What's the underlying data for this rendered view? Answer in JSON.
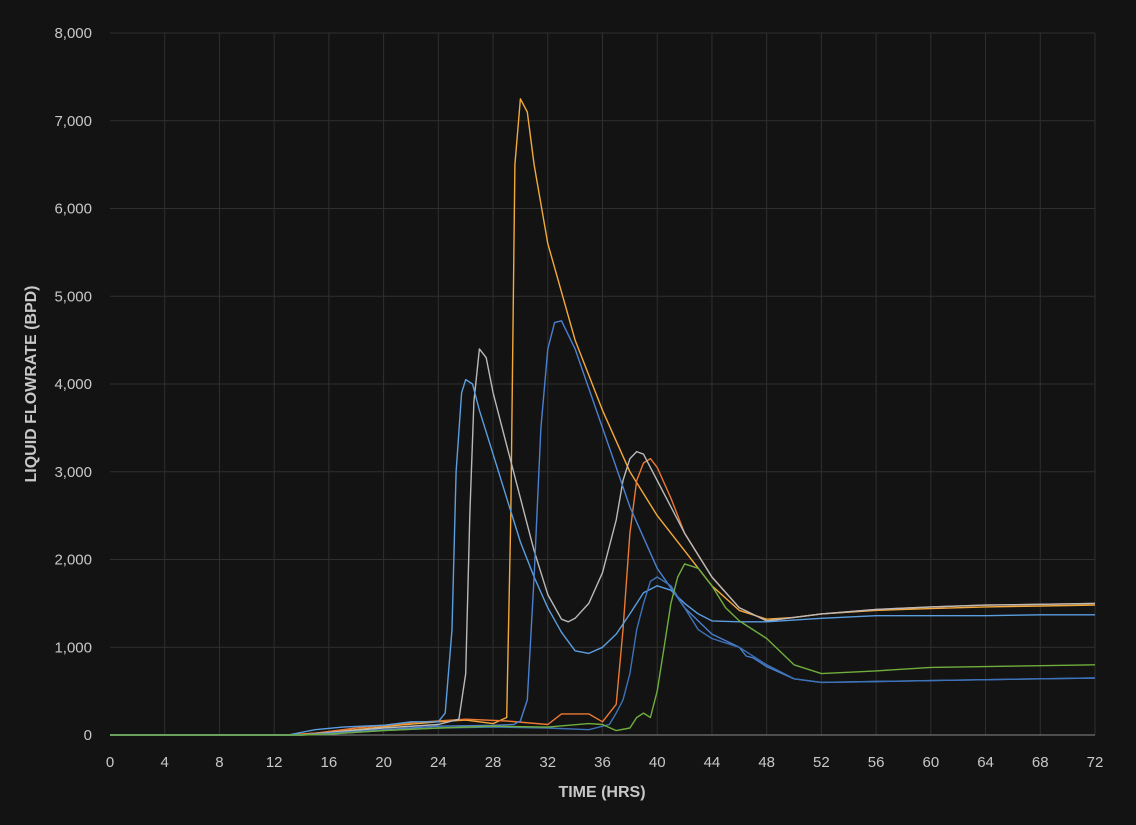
{
  "chart_data": {
    "type": "line",
    "xlabel": "TIME (HRS)",
    "ylabel": "LIQUID FLOWRATE (BPD)",
    "xlim": [
      0,
      72
    ],
    "ylim": [
      0,
      8000
    ],
    "x_ticks": [
      "0",
      "4",
      "8",
      "12",
      "16",
      "20",
      "24",
      "28",
      "32",
      "36",
      "40",
      "44",
      "48",
      "52",
      "56",
      "60",
      "64",
      "68",
      "72"
    ],
    "y_ticks": [
      "0",
      "1,000",
      "2,000",
      "3,000",
      "4,000",
      "5,000",
      "6,000",
      "7,000",
      "8,000"
    ],
    "grid": true,
    "background": "#131313",
    "series": [
      {
        "color": "#f2a93b",
        "points": [
          [
            0,
            0
          ],
          [
            13,
            0
          ],
          [
            15,
            20
          ],
          [
            18,
            60
          ],
          [
            21,
            110
          ],
          [
            24,
            150
          ],
          [
            26,
            170
          ],
          [
            28,
            130
          ],
          [
            29,
            200
          ],
          [
            29.3,
            2500
          ],
          [
            29.6,
            6500
          ],
          [
            30,
            7250
          ],
          [
            30.5,
            7100
          ],
          [
            31,
            6500
          ],
          [
            32,
            5600
          ],
          [
            34,
            4500
          ],
          [
            36,
            3700
          ],
          [
            38,
            3000
          ],
          [
            40,
            2500
          ],
          [
            42,
            2100
          ],
          [
            44,
            1700
          ],
          [
            46,
            1420
          ],
          [
            48,
            1320
          ],
          [
            50,
            1340
          ],
          [
            52,
            1380
          ],
          [
            56,
            1420
          ],
          [
            60,
            1440
          ],
          [
            64,
            1460
          ],
          [
            68,
            1470
          ],
          [
            72,
            1480
          ]
        ]
      },
      {
        "color": "#ea7a34",
        "points": [
          [
            0,
            0
          ],
          [
            13,
            0
          ],
          [
            15,
            20
          ],
          [
            18,
            80
          ],
          [
            22,
            140
          ],
          [
            26,
            180
          ],
          [
            29,
            160
          ],
          [
            32,
            120
          ],
          [
            33,
            240
          ],
          [
            35,
            240
          ],
          [
            36,
            150
          ],
          [
            37,
            350
          ],
          [
            37.5,
            1200
          ],
          [
            38,
            2300
          ],
          [
            38.5,
            2900
          ],
          [
            39,
            3100
          ],
          [
            39.5,
            3150
          ],
          [
            40,
            3050
          ],
          [
            41,
            2700
          ],
          [
            42,
            2300
          ],
          [
            44,
            1800
          ],
          [
            46,
            1450
          ],
          [
            48,
            1300
          ],
          [
            50,
            1340
          ],
          [
            52,
            1380
          ],
          [
            56,
            1430
          ],
          [
            60,
            1460
          ],
          [
            64,
            1480
          ],
          [
            68,
            1490
          ],
          [
            72,
            1500
          ]
        ]
      },
      {
        "color": "#b9b9b9",
        "points": [
          [
            0,
            0
          ],
          [
            14,
            0
          ],
          [
            16,
            30
          ],
          [
            20,
            80
          ],
          [
            24,
            120
          ],
          [
            25.5,
            180
          ],
          [
            26,
            700
          ],
          [
            26.3,
            2500
          ],
          [
            26.6,
            3800
          ],
          [
            27,
            4400
          ],
          [
            27.5,
            4300
          ],
          [
            28,
            3900
          ],
          [
            29,
            3300
          ],
          [
            30,
            2700
          ],
          [
            31,
            2100
          ],
          [
            32,
            1600
          ],
          [
            33,
            1320
          ],
          [
            33.5,
            1290
          ],
          [
            34,
            1330
          ],
          [
            35,
            1500
          ],
          [
            36,
            1850
          ],
          [
            37,
            2450
          ],
          [
            37.5,
            2900
          ],
          [
            38,
            3150
          ],
          [
            38.5,
            3230
          ],
          [
            39,
            3200
          ],
          [
            40,
            2900
          ],
          [
            42,
            2300
          ],
          [
            44,
            1800
          ],
          [
            46,
            1450
          ],
          [
            48,
            1300
          ],
          [
            50,
            1340
          ],
          [
            52,
            1380
          ],
          [
            56,
            1430
          ],
          [
            60,
            1460
          ],
          [
            64,
            1480
          ],
          [
            68,
            1490
          ],
          [
            72,
            1500
          ]
        ]
      },
      {
        "color": "#5b9ee0",
        "points": [
          [
            0,
            0
          ],
          [
            13,
            0
          ],
          [
            15,
            60
          ],
          [
            17,
            90
          ],
          [
            20,
            110
          ],
          [
            22,
            150
          ],
          [
            24,
            150
          ],
          [
            24.5,
            250
          ],
          [
            25,
            1200
          ],
          [
            25.3,
            3000
          ],
          [
            25.7,
            3900
          ],
          [
            26,
            4050
          ],
          [
            26.5,
            4000
          ],
          [
            27,
            3700
          ],
          [
            28,
            3200
          ],
          [
            29,
            2700
          ],
          [
            30,
            2200
          ],
          [
            31,
            1800
          ],
          [
            32,
            1450
          ],
          [
            33,
            1170
          ],
          [
            34,
            960
          ],
          [
            35,
            930
          ],
          [
            36,
            1000
          ],
          [
            37,
            1150
          ],
          [
            38,
            1380
          ],
          [
            39,
            1620
          ],
          [
            40,
            1700
          ],
          [
            41,
            1650
          ],
          [
            42,
            1500
          ],
          [
            43,
            1380
          ],
          [
            44,
            1300
          ],
          [
            46,
            1290
          ],
          [
            48,
            1290
          ],
          [
            52,
            1330
          ],
          [
            56,
            1360
          ],
          [
            60,
            1360
          ],
          [
            64,
            1360
          ],
          [
            68,
            1370
          ],
          [
            72,
            1370
          ]
        ]
      },
      {
        "color": "#4a80cf",
        "points": [
          [
            0,
            0
          ],
          [
            14,
            0
          ],
          [
            16,
            20
          ],
          [
            20,
            60
          ],
          [
            24,
            100
          ],
          [
            28,
            110
          ],
          [
            29.5,
            120
          ],
          [
            30,
            160
          ],
          [
            30.5,
            400
          ],
          [
            31,
            1800
          ],
          [
            31.5,
            3500
          ],
          [
            32,
            4400
          ],
          [
            32.5,
            4700
          ],
          [
            33,
            4720
          ],
          [
            34,
            4400
          ],
          [
            36,
            3500
          ],
          [
            38,
            2600
          ],
          [
            40,
            1900
          ],
          [
            42,
            1450
          ],
          [
            44,
            1150
          ],
          [
            46,
            1000
          ],
          [
            46.5,
            900
          ],
          [
            47,
            880
          ],
          [
            48,
            780
          ],
          [
            50,
            640
          ],
          [
            52,
            600
          ],
          [
            56,
            610
          ],
          [
            60,
            620
          ],
          [
            64,
            630
          ],
          [
            68,
            640
          ],
          [
            72,
            650
          ]
        ]
      },
      {
        "color": "#3e72b8",
        "points": [
          [
            0,
            0
          ],
          [
            14,
            0
          ],
          [
            16,
            10
          ],
          [
            20,
            50
          ],
          [
            24,
            80
          ],
          [
            28,
            90
          ],
          [
            32,
            80
          ],
          [
            35,
            60
          ],
          [
            36.5,
            120
          ],
          [
            37,
            250
          ],
          [
            37.5,
            400
          ],
          [
            38,
            700
          ],
          [
            38.5,
            1200
          ],
          [
            39,
            1500
          ],
          [
            39.5,
            1750
          ],
          [
            40,
            1800
          ],
          [
            41,
            1700
          ],
          [
            42,
            1450
          ],
          [
            43,
            1200
          ],
          [
            44,
            1100
          ],
          [
            46,
            1000
          ],
          [
            48,
            800
          ],
          [
            50,
            640
          ],
          [
            52,
            600
          ],
          [
            56,
            610
          ],
          [
            60,
            620
          ],
          [
            64,
            630
          ],
          [
            68,
            640
          ],
          [
            72,
            650
          ]
        ]
      },
      {
        "color": "#6fae3c",
        "points": [
          [
            0,
            0
          ],
          [
            14,
            0
          ],
          [
            16,
            10
          ],
          [
            20,
            50
          ],
          [
            24,
            80
          ],
          [
            28,
            100
          ],
          [
            32,
            90
          ],
          [
            35,
            130
          ],
          [
            36,
            120
          ],
          [
            37,
            50
          ],
          [
            38,
            80
          ],
          [
            38.5,
            200
          ],
          [
            39,
            250
          ],
          [
            39.5,
            200
          ],
          [
            40,
            500
          ],
          [
            40.5,
            1000
          ],
          [
            41,
            1500
          ],
          [
            41.5,
            1800
          ],
          [
            42,
            1950
          ],
          [
            43,
            1900
          ],
          [
            44,
            1700
          ],
          [
            45,
            1450
          ],
          [
            46,
            1300
          ],
          [
            48,
            1100
          ],
          [
            50,
            800
          ],
          [
            52,
            700
          ],
          [
            56,
            730
          ],
          [
            60,
            770
          ],
          [
            64,
            780
          ],
          [
            68,
            790
          ],
          [
            72,
            800
          ]
        ]
      }
    ]
  }
}
